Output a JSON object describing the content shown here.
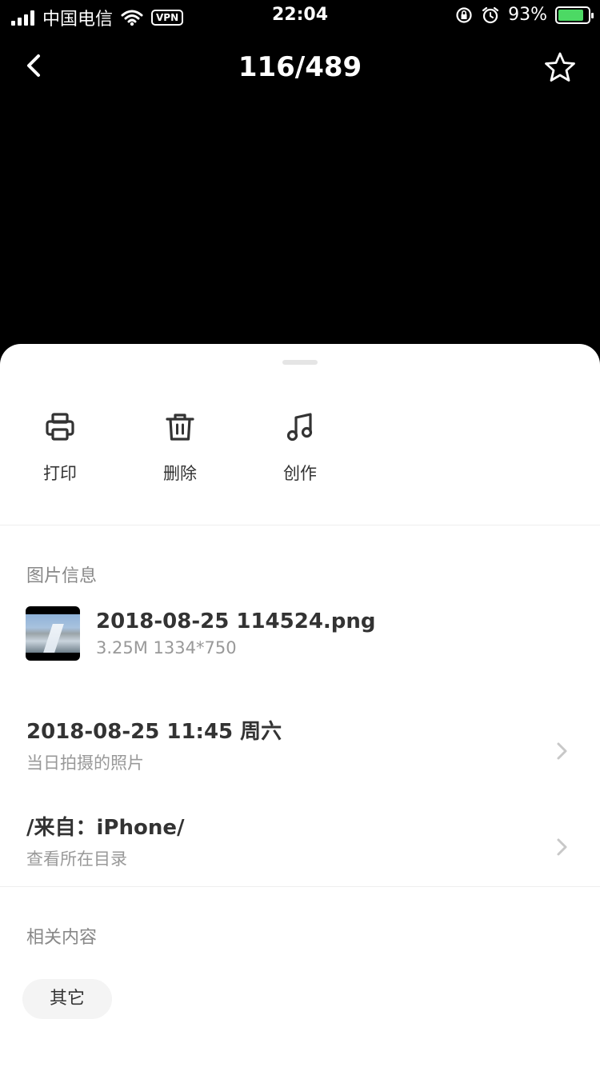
{
  "status": {
    "carrier": "中国电信",
    "vpn": "VPN",
    "time": "22:04",
    "battery": "93%"
  },
  "nav": {
    "title": "116/489"
  },
  "actions": [
    {
      "label": "打印",
      "icon": "printer-icon"
    },
    {
      "label": "删除",
      "icon": "trash-icon"
    },
    {
      "label": "创作",
      "icon": "music-note-icon"
    }
  ],
  "image_info": {
    "section_title": "图片信息",
    "file_name": "2018-08-25 114524.png",
    "file_meta": "3.25M 1334*750"
  },
  "date_row": {
    "main": "2018-08-25 11:45 周六",
    "sub": "当日拍摄的照片"
  },
  "source_row": {
    "main": "/来自：iPhone/",
    "sub": "查看所在目录"
  },
  "related": {
    "section_title": "相关内容",
    "tags": [
      "其它"
    ]
  },
  "colors": {
    "battery_fill": "#4cd964",
    "background_top": "#000000",
    "sheet": "#ffffff"
  }
}
